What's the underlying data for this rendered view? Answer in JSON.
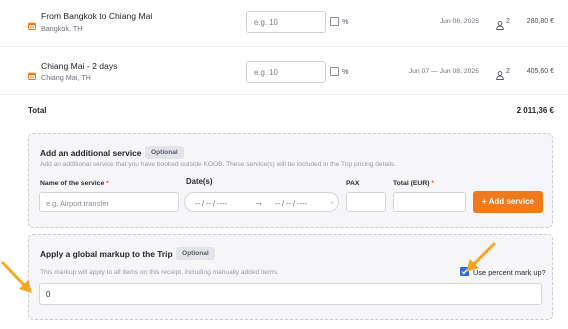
{
  "rows": [
    {
      "title": "From Bangkok to Chiang Mai",
      "location": "Bangkok, TH",
      "markup_placeholder": "e.g. 10",
      "percent_label": "%",
      "dates": "Jun 06, 2025",
      "pax": "2",
      "price": "280,80 €"
    },
    {
      "title": "Chiang Mai - 2 days",
      "location": "Chiang Mai, TH",
      "markup_placeholder": "e.g. 10",
      "percent_label": "%",
      "dates": "Jun 07 — Jun 08, 2025",
      "pax": "2",
      "price": "405,60 €"
    }
  ],
  "total": {
    "label": "Total",
    "value": "2 011,36 €"
  },
  "additional_service": {
    "title": "Add an additional service",
    "badge": "Optional",
    "description": "Add an additional service that you have booked outside KOOB. These service(s) will be included in the Trip pricing details.",
    "name_label": "Name of the service",
    "name_placeholder": "e.g. Airport transfer",
    "date_label": "Date(s)",
    "date_from": "-- / -- / ----",
    "date_to": "-- / -- / ----",
    "pax_label": "PAX",
    "total_label": "Total (EUR)",
    "required_mark": "*",
    "add_button": "+ Add service"
  },
  "global_markup": {
    "title": "Apply a global markup to the Trip",
    "badge": "Optional",
    "description": "This markup will apply to all items on this receipt, including manually added items.",
    "percent_checkbox_label": "Use percent mark up?",
    "percent_checked": true,
    "value": "0"
  },
  "colors": {
    "accent": "#ef7a1b",
    "checkbox": "#2d6fd8",
    "annotation_arrow": "#f5a623"
  },
  "icons": {
    "row_type": "hotel-icon",
    "pax": "person-icon"
  }
}
